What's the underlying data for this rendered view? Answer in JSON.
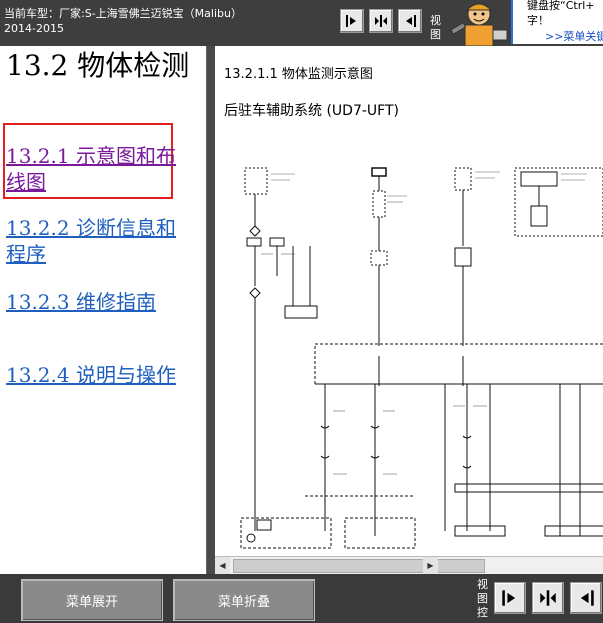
{
  "topbar": {
    "vehicle_line1": "当前车型：厂家:S-上海雪佛兰迈锐宝（Malibu）",
    "vehicle_line2": "2014-2015",
    "view_label": "视图",
    "hint_line1": "键盘按“Ctrl+",
    "hint_line2": "字！",
    "hint_link": ">>菜单关键"
  },
  "left": {
    "section_title": "13.2 物体检测",
    "toc": [
      {
        "label": "13.2.1 示意图和布线图"
      },
      {
        "label": "13.2.2 诊断信息和程序"
      },
      {
        "label": "13.2.3 维修指南"
      },
      {
        "label": "13.2.4 说明与操作"
      }
    ]
  },
  "right": {
    "title": "13.2.1.1 物体监测示意图",
    "subtitle": "后驻车辅助系统 (UD7-UFT)"
  },
  "bottom": {
    "expand_label": "菜单展开",
    "collapse_label": "菜单折叠",
    "view_control_label": "视图控"
  },
  "colors": {
    "link": "#1f5fbf",
    "visited_link": "#7a1a9a",
    "highlight_frame": "#e02020"
  }
}
